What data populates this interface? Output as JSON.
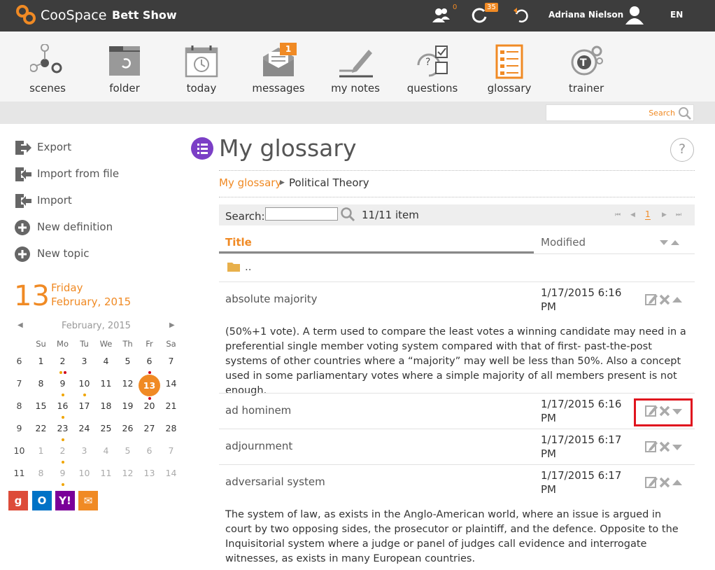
{
  "app": {
    "brand": "CooSpace",
    "course": "Bett Show"
  },
  "topbar": {
    "people_count": "0",
    "activity_count": "35",
    "user_name": "Adriana Nielson",
    "language": "EN",
    "accent": "#f08a24"
  },
  "nav": {
    "items": [
      {
        "label": "scenes",
        "icon": "scenes-icon"
      },
      {
        "label": "folder",
        "icon": "folder-icon"
      },
      {
        "label": "today",
        "icon": "calendar-icon"
      },
      {
        "label": "messages",
        "icon": "envelope-icon",
        "badge": "1"
      },
      {
        "label": "my notes",
        "icon": "pencil-icon"
      },
      {
        "label": "questions",
        "icon": "questions-icon"
      },
      {
        "label": "glossary",
        "icon": "glossary-icon"
      },
      {
        "label": "trainer",
        "icon": "trainer-icon"
      }
    ]
  },
  "global_search": {
    "placeholder": "Search"
  },
  "sidebar": {
    "actions": [
      "Export",
      "Import from file",
      "Import",
      "New definition",
      "New topic"
    ]
  },
  "date": {
    "day": "13",
    "weekday": "Friday",
    "month_year": "February, 2015"
  },
  "calendar": {
    "title": "February, 2015",
    "weekdays": [
      "Su",
      "Mo",
      "Tu",
      "We",
      "Th",
      "Fr",
      "Sa"
    ],
    "weeks": [
      {
        "week": "6",
        "days": [
          "1",
          "2",
          "3",
          "4",
          "5",
          "6",
          "7"
        ]
      },
      {
        "week": "7",
        "days": [
          "8",
          "9",
          "10",
          "11",
          "12",
          "13",
          "14"
        ]
      },
      {
        "week": "8",
        "days": [
          "15",
          "16",
          "17",
          "18",
          "19",
          "20",
          "21"
        ]
      },
      {
        "week": "9",
        "days": [
          "22",
          "23",
          "24",
          "25",
          "26",
          "27",
          "28"
        ]
      },
      {
        "week": "10",
        "days": [
          "1",
          "2",
          "3",
          "4",
          "5",
          "6",
          "7"
        ]
      },
      {
        "week": "11",
        "days": [
          "8",
          "9",
          "10",
          "11",
          "12",
          "13",
          "14"
        ]
      }
    ]
  },
  "providers": [
    "google-icon",
    "outlook-icon",
    "yahoo-icon",
    "mail-icon"
  ],
  "page": {
    "title": "My glossary"
  },
  "breadcrumb": {
    "root": "My glossary",
    "current": "Political Theory"
  },
  "listbar": {
    "search_label": "Search:",
    "count": "11/11 item",
    "page": "1"
  },
  "table": {
    "col_title": "Title",
    "col_modified": "Modified",
    "parent": "..",
    "rows": [
      {
        "title": "absolute majority",
        "date": "1/17/2015 6:16 PM",
        "definition": "(50%+1 vote). A term used to compare the least votes a winning candidate may need in a preferential single member voting system compared with that of first- past-the-post systems of other countries where a “majority” may well be less than 50%.  Also a concept used in some parliamentary votes where a simple majority of all members present is not enough."
      },
      {
        "title": "ad hominem",
        "date": "1/17/2015 6:16 PM"
      },
      {
        "title": "adjournment",
        "date": "1/17/2015 6:17 PM"
      },
      {
        "title": "adversarial system",
        "date": "1/17/2015 6:17 PM",
        "definition": "The system of law, as exists in the Anglo-American world, where an issue is argued in court by two opposing sides, the prosecutor or plaintiff, and the defence. Opposite to the Inquisitorial system where a judge or panel of judges call evidence and interrogate witnesses, as exists in many European countries."
      }
    ]
  }
}
